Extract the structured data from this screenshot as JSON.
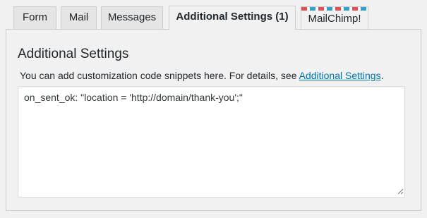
{
  "tabs": [
    {
      "label": "Form",
      "active": false
    },
    {
      "label": "Mail",
      "active": false
    },
    {
      "label": "Messages",
      "active": false
    },
    {
      "label": "Additional Settings (1)",
      "active": true
    },
    {
      "label": "MailChimp!",
      "active": false
    }
  ],
  "panel": {
    "title": "Additional Settings",
    "description_prefix": "You can add customization code snippets here. For details, see ",
    "description_link": "Additional Settings",
    "description_suffix": ".",
    "textarea_value": "on_sent_ok: \"location = 'http://domain/thank-you';\""
  },
  "colors": {
    "link": "#0073aa",
    "mailchimp_red": "#e34f4f",
    "mailchimp_blue": "#2ea2cc"
  }
}
